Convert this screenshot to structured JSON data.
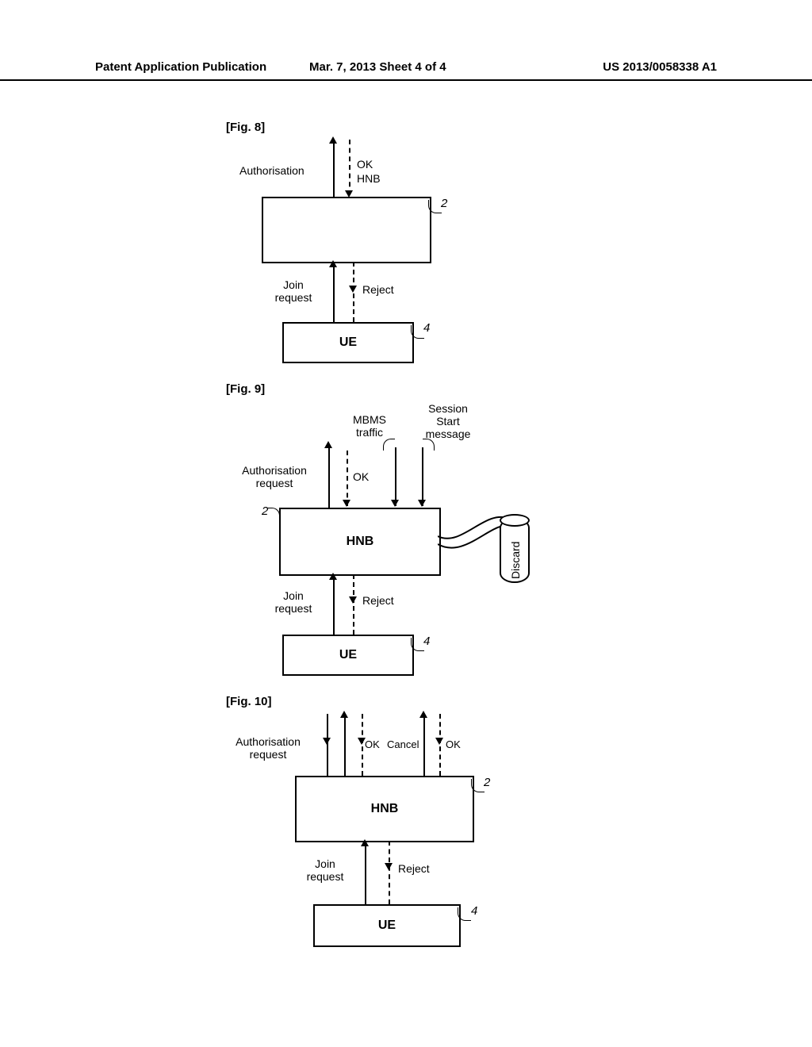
{
  "header": {
    "left": "Patent Application Publication",
    "mid": "Mar. 7, 2013  Sheet 4 of 4",
    "right": "US 2013/0058338 A1"
  },
  "fig8": {
    "label": "[Fig. 8]",
    "auth": "Authorisation",
    "ok": "OK",
    "hnb_top": "HNB",
    "hnb": "",
    "join1": "Join",
    "join2": "request",
    "reject": "Reject",
    "ue": "UE",
    "ref2": "2",
    "ref4": "4"
  },
  "fig9": {
    "label": "[Fig. 9]",
    "auth1": "Authorisation",
    "auth2": "request",
    "ok": "OK",
    "mbms1": "MBMS",
    "mbms2": "traffic",
    "sess1": "Session",
    "sess2": "Start",
    "sess3": "message",
    "hnb": "HNB",
    "join1": "Join",
    "join2": "request",
    "reject": "Reject",
    "ue": "UE",
    "ref2": "2",
    "ref4": "4",
    "discard": "Discard"
  },
  "fig10": {
    "label": "[Fig. 10]",
    "auth1": "Authorisation",
    "auth2": "request",
    "ok1": "OK",
    "cancel": "Cancel",
    "ok2": "OK",
    "hnb": "HNB",
    "join1": "Join",
    "join2": "request",
    "reject": "Reject",
    "ue": "UE",
    "ref2": "2",
    "ref4": "4"
  }
}
